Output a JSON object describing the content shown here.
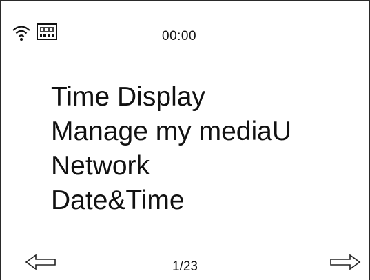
{
  "status_bar": {
    "time": "00:00",
    "icons": [
      "wifi-icon",
      "network-icon"
    ]
  },
  "menu": {
    "items": [
      {
        "label": "Time Display"
      },
      {
        "label": "Manage my mediaU"
      },
      {
        "label": "Network"
      },
      {
        "label": "Date&Time"
      }
    ]
  },
  "navigation": {
    "page_indicator": "1/23",
    "prev_icon": "arrow-left-icon",
    "next_icon": "arrow-right-icon"
  }
}
